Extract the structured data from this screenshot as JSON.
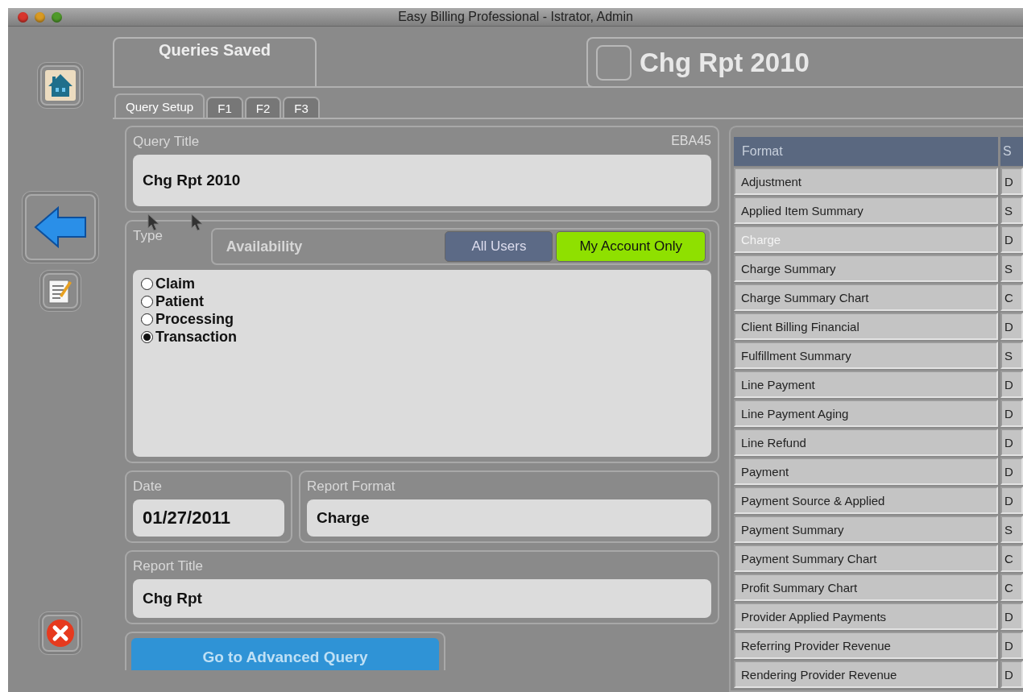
{
  "window": {
    "title": "Easy Billing Professional - Istrator, Admin"
  },
  "top_tab": {
    "label": "Queries Saved"
  },
  "banner": {
    "checked": false,
    "title": "Chg Rpt 2010"
  },
  "tabs": [
    {
      "label": "Query Setup",
      "selected": true
    },
    {
      "label": "F1",
      "selected": false
    },
    {
      "label": "F2",
      "selected": false
    },
    {
      "label": "F3",
      "selected": false
    }
  ],
  "query_title": {
    "label": "Query Title",
    "code": "EBA45",
    "value": "Chg Rpt 2010"
  },
  "type": {
    "label": "Type",
    "availability_label": "Availability",
    "availability": [
      {
        "label": "All Users",
        "selected": false
      },
      {
        "label": "My Account Only",
        "selected": true
      }
    ],
    "options": [
      {
        "label": "Claim",
        "selected": false
      },
      {
        "label": "Patient",
        "selected": false
      },
      {
        "label": "Processing",
        "selected": false
      },
      {
        "label": "Transaction",
        "selected": true
      }
    ]
  },
  "date": {
    "label": "Date",
    "value": "01/27/2011"
  },
  "report_format": {
    "label": "Report Format",
    "value": "Charge"
  },
  "report_title": {
    "label": "Report Title",
    "value": "Chg Rpt"
  },
  "advanced_button": "Go to Advanced Query",
  "table": {
    "columns": [
      "Format",
      "S"
    ],
    "rows": [
      {
        "cells": [
          "Adjustment",
          "D"
        ],
        "selected": false
      },
      {
        "cells": [
          "Applied Item Summary",
          "S"
        ],
        "selected": false
      },
      {
        "cells": [
          "Charge",
          "D"
        ],
        "selected": true
      },
      {
        "cells": [
          "Charge Summary",
          "S"
        ],
        "selected": false
      },
      {
        "cells": [
          "Charge Summary Chart",
          "C"
        ],
        "selected": false
      },
      {
        "cells": [
          "Client Billing Financial",
          "D"
        ],
        "selected": false
      },
      {
        "cells": [
          "Fulfillment Summary",
          "S"
        ],
        "selected": false
      },
      {
        "cells": [
          "Line Payment",
          "D"
        ],
        "selected": false
      },
      {
        "cells": [
          "Line Payment Aging",
          "D"
        ],
        "selected": false
      },
      {
        "cells": [
          "Line Refund",
          "D"
        ],
        "selected": false
      },
      {
        "cells": [
          "Payment",
          "D"
        ],
        "selected": false
      },
      {
        "cells": [
          "Payment Source & Applied",
          "D"
        ],
        "selected": false
      },
      {
        "cells": [
          "Payment Summary",
          "S"
        ],
        "selected": false
      },
      {
        "cells": [
          "Payment Summary Chart",
          "C"
        ],
        "selected": false
      },
      {
        "cells": [
          "Profit Summary Chart",
          "C"
        ],
        "selected": false
      },
      {
        "cells": [
          "Provider Applied Payments",
          "D"
        ],
        "selected": false
      },
      {
        "cells": [
          "Referring Provider Revenue",
          "D"
        ],
        "selected": false
      },
      {
        "cells": [
          "Rendering Provider Revenue",
          "D"
        ],
        "selected": false
      }
    ]
  }
}
